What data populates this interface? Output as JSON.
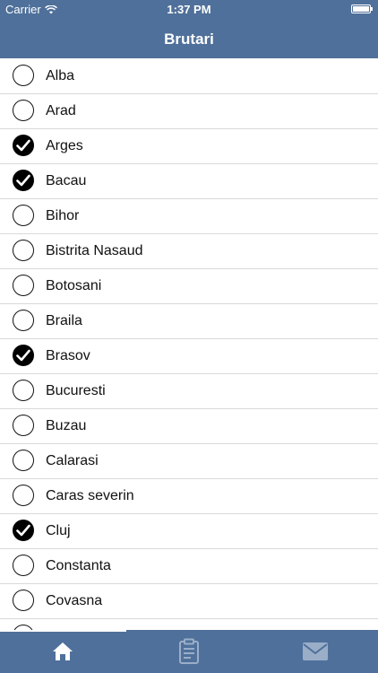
{
  "status_bar": {
    "carrier": "Carrier",
    "time": "1:37 PM"
  },
  "nav": {
    "title": "Brutari"
  },
  "items": [
    {
      "label": "Alba",
      "checked": false
    },
    {
      "label": "Arad",
      "checked": false
    },
    {
      "label": "Arges",
      "checked": true
    },
    {
      "label": "Bacau",
      "checked": true
    },
    {
      "label": "Bihor",
      "checked": false
    },
    {
      "label": "Bistrita Nasaud",
      "checked": false
    },
    {
      "label": "Botosani",
      "checked": false
    },
    {
      "label": "Braila",
      "checked": false
    },
    {
      "label": "Brasov",
      "checked": true
    },
    {
      "label": "Bucuresti",
      "checked": false
    },
    {
      "label": "Buzau",
      "checked": false
    },
    {
      "label": "Calarasi",
      "checked": false
    },
    {
      "label": "Caras severin",
      "checked": false
    },
    {
      "label": "Cluj",
      "checked": true
    },
    {
      "label": "Constanta",
      "checked": false
    },
    {
      "label": "Covasna",
      "checked": false
    },
    {
      "label": "",
      "checked": false
    }
  ],
  "tab_bar": {
    "tabs": [
      {
        "icon": "home-icon",
        "selected": true
      },
      {
        "icon": "clipboard-icon",
        "selected": false
      },
      {
        "icon": "mail-icon",
        "selected": false
      }
    ]
  },
  "colors": {
    "bar": "#4f709a",
    "tab_inactive": "#9aaec8",
    "tab_active": "#ffffff"
  }
}
